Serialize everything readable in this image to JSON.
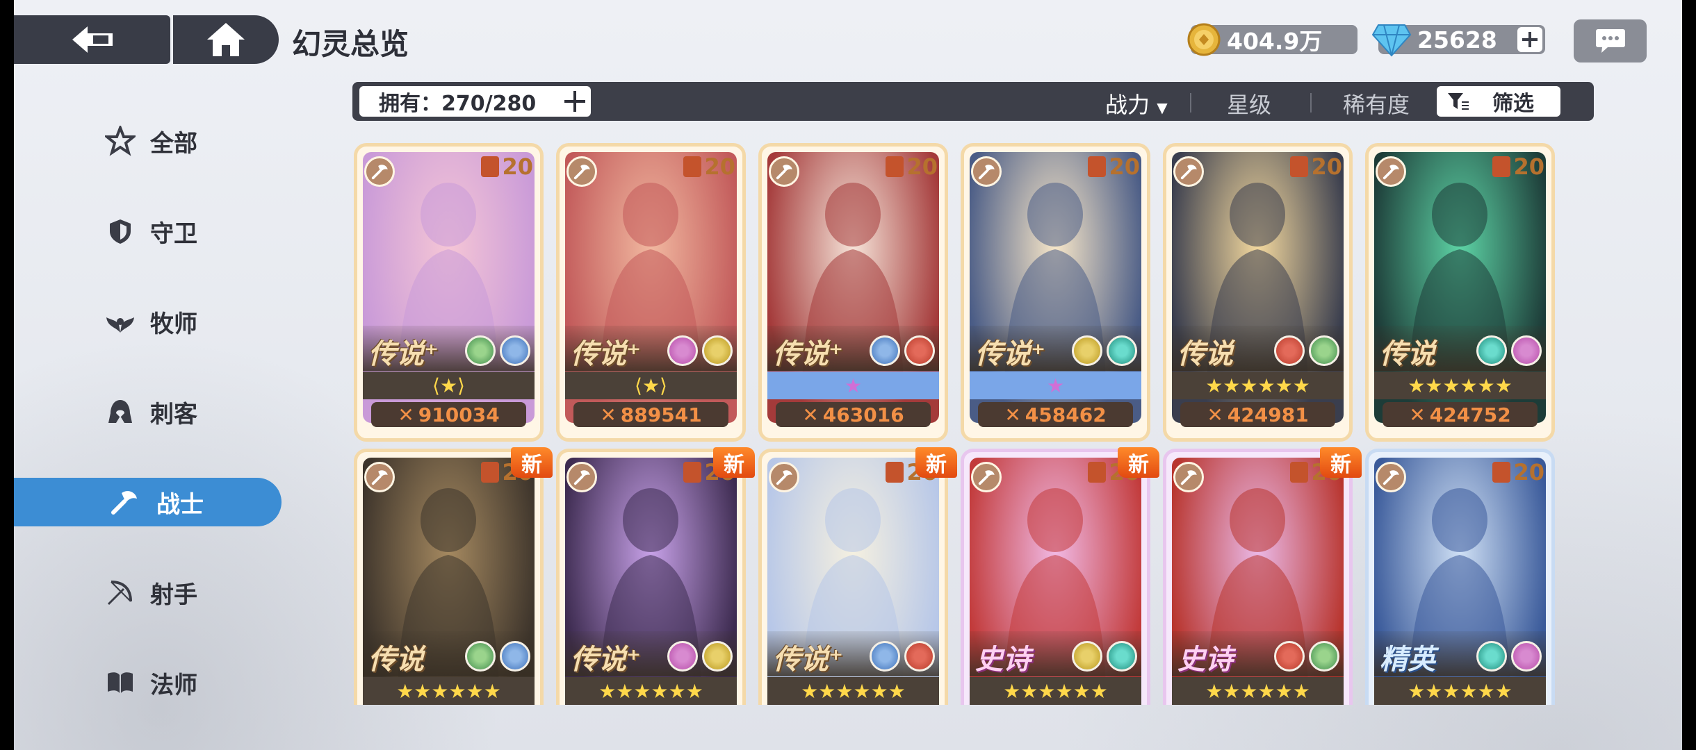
{
  "header": {
    "title": "幻灵总览",
    "coins": "404.9万",
    "gems": "25628"
  },
  "sidebar": {
    "items": [
      {
        "label": "全部",
        "icon": "star-outline-icon"
      },
      {
        "label": "守卫",
        "icon": "shield-icon"
      },
      {
        "label": "牧师",
        "icon": "wings-icon"
      },
      {
        "label": "刺客",
        "icon": "hood-icon"
      },
      {
        "label": "战士",
        "icon": "axe-icon",
        "active": true
      },
      {
        "label": "射手",
        "icon": "bow-icon"
      },
      {
        "label": "法师",
        "icon": "book-icon"
      }
    ]
  },
  "filter_bar": {
    "owned_label": "拥有：270/280",
    "sort_power": "战力",
    "sort_star": "星级",
    "sort_rarity": "稀有度",
    "filter_label": "筛选"
  },
  "new_tag": "新",
  "cards": [
    {
      "rarity": "传说",
      "plus": true,
      "level": "20",
      "power": "910034",
      "stars": "awaken-wings",
      "colors": [
        "#f5c6d6",
        "#c99ad8"
      ]
    },
    {
      "rarity": "传说",
      "plus": true,
      "level": "20",
      "power": "889541",
      "stars": "awaken-wings",
      "colors": [
        "#f1b8a0",
        "#c25a5a"
      ]
    },
    {
      "rarity": "传说",
      "plus": true,
      "level": "20",
      "power": "463016",
      "stars": "blue-single",
      "colors": [
        "#f5e3d8",
        "#a43a3a"
      ]
    },
    {
      "rarity": "传说",
      "plus": true,
      "level": "20",
      "power": "458462",
      "stars": "blue-single",
      "colors": [
        "#f7e6c8",
        "#4a5c86"
      ]
    },
    {
      "rarity": "传说",
      "plus": false,
      "level": "20",
      "power": "424981",
      "stars": "six",
      "colors": [
        "#f3d89e",
        "#3a3e4e"
      ]
    },
    {
      "rarity": "传说",
      "plus": false,
      "level": "20",
      "power": "424752",
      "stars": "six",
      "colors": [
        "#5dd3a5",
        "#1d3c38"
      ]
    },
    {
      "rarity": "传说",
      "plus": false,
      "level": "20",
      "new": true,
      "stars": "six",
      "colors": [
        "#a58960",
        "#3d342b"
      ]
    },
    {
      "rarity": "传说",
      "plus": true,
      "level": "20",
      "new": true,
      "stars": "six",
      "colors": [
        "#c7a1e8",
        "#3d2b50"
      ]
    },
    {
      "rarity": "传说",
      "plus": true,
      "level": "20",
      "new": true,
      "stars": "six",
      "colors": [
        "#f5f0e0",
        "#b7c7e8"
      ]
    },
    {
      "rarity": "史诗",
      "plus": false,
      "level": "20",
      "new": true,
      "stars": "six",
      "colors": [
        "#f0b8e3",
        "#c23b3b"
      ],
      "variant": "epic"
    },
    {
      "rarity": "史诗",
      "plus": false,
      "level": "20",
      "new": true,
      "stars": "six",
      "colors": [
        "#eab8e6",
        "#b8352e"
      ],
      "variant": "epic"
    },
    {
      "rarity": "精英",
      "plus": false,
      "level": "20",
      "stars": "six",
      "colors": [
        "#cfe0f5",
        "#3a5a9a"
      ],
      "variant": "elite"
    }
  ],
  "colors": {
    "accent": "#3c8dd4",
    "dark_bar": "#3d3f49",
    "power_text": "#f29046"
  }
}
